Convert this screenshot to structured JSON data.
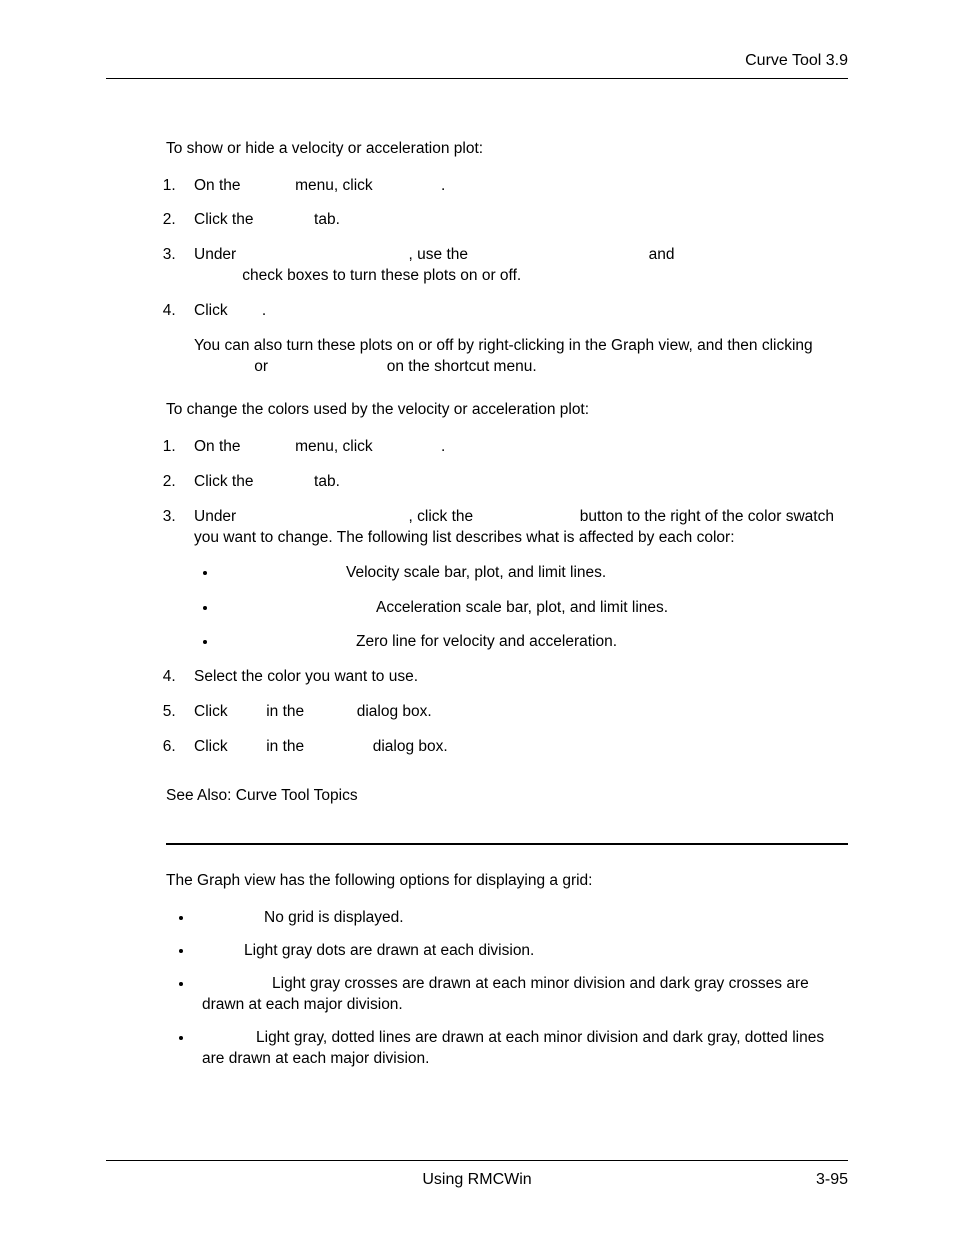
{
  "header": {
    "right": "Curve Tool  3.9"
  },
  "section1": {
    "intro": "To show or hide a velocity or acceleration plot:",
    "steps": {
      "s1": {
        "t1": "On the ",
        "t2": " menu, click ",
        "t3": "."
      },
      "s2": {
        "t1": "Click the ",
        "t2": " tab."
      },
      "s3": {
        "t1": "Under ",
        "t2": ", use the ",
        "t3": " and ",
        "t4": " check boxes to turn these plots on or off."
      },
      "s4": {
        "t1": "Click ",
        "t2": "."
      }
    },
    "note": {
      "t1": "You can also turn these plots on or off by right-clicking in the Graph view, and then clicking ",
      "t2": " or ",
      "t3": " on the shortcut menu."
    }
  },
  "section2": {
    "intro": "To change the colors used by the velocity or acceleration plot:",
    "steps": {
      "s1": {
        "t1": "On the ",
        "t2": " menu, click ",
        "t3": "."
      },
      "s2": {
        "t1": "Click the ",
        "t2": " tab."
      },
      "s3": {
        "t1": "Under ",
        "t2": ", click the ",
        "t3": " button to the right of the color swatch you want to change. The following list describes what is affected by each color:"
      },
      "bullets": {
        "b1": "Velocity scale bar, plot, and limit lines.",
        "b2": "Acceleration scale bar, plot, and limit lines.",
        "b3": "Zero line for velocity and acceleration."
      },
      "s4": "Select the color you want to use.",
      "s5": {
        "t1": "Click ",
        "t2": " in the ",
        "t3": " dialog box."
      },
      "s6": {
        "t1": "Click ",
        "t2": " in the ",
        "t3": " dialog box."
      }
    },
    "seeAlso": "See Also: Curve Tool Topics"
  },
  "section3": {
    "intro": "The Graph view has the following options for displaying a grid:",
    "bullets": {
      "b1": "No grid is displayed.",
      "b2": "Light gray dots are drawn at each division.",
      "b3": "Light gray crosses are drawn at each minor division and dark gray crosses are drawn at each major division.",
      "b4": "Light gray, dotted lines are drawn at each minor division and dark gray, dotted lines are drawn at each major division."
    }
  },
  "footer": {
    "center": "Using RMCWin",
    "right": "3-95"
  }
}
